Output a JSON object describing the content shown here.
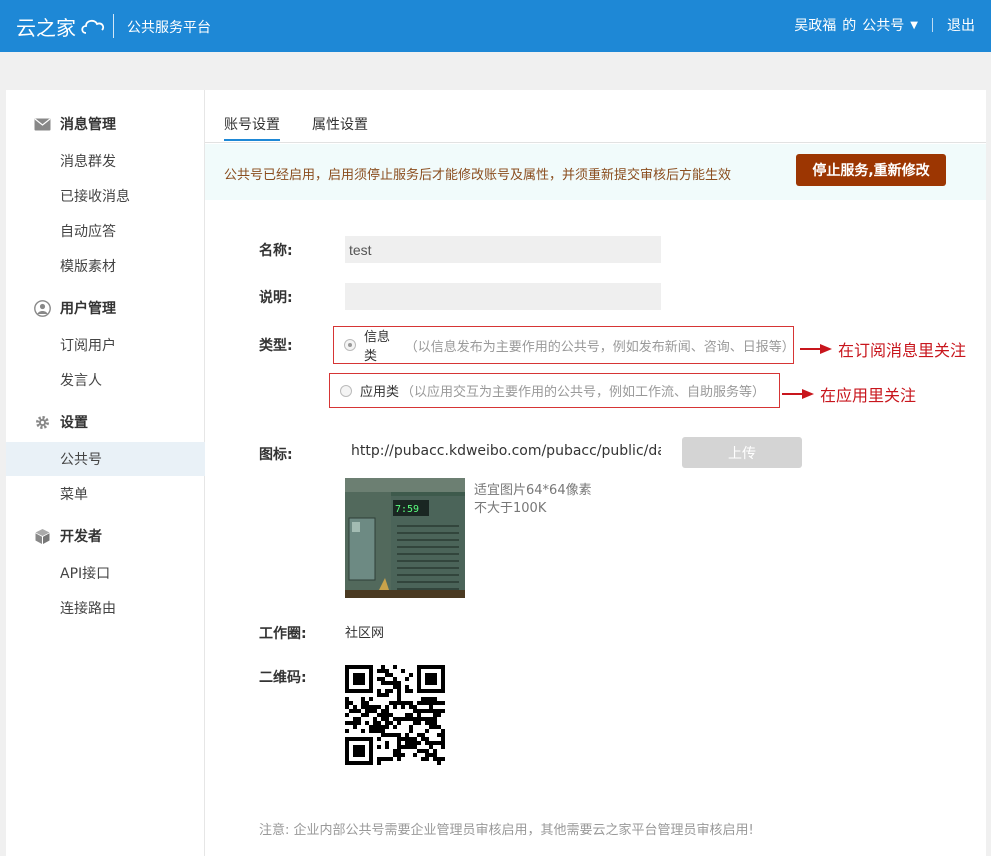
{
  "header": {
    "logo_text": "云之家",
    "platform": "公共服务平台",
    "user_name": "吴政福",
    "user_of": "的",
    "account_menu": "公共号",
    "logout": "退出"
  },
  "sidebar": {
    "groups": [
      {
        "label": "消息管理",
        "icon": "envelope-icon",
        "items": [
          "消息群发",
          "已接收消息",
          "自动应答",
          "模版素材"
        ]
      },
      {
        "label": "用户管理",
        "icon": "user-icon",
        "items": [
          "订阅用户",
          "发言人"
        ]
      },
      {
        "label": "设置",
        "icon": "gear-icon",
        "items": [
          "公共号",
          "菜单"
        ]
      },
      {
        "label": "开发者",
        "icon": "cube-icon",
        "items": [
          "API接口",
          "连接路由"
        ]
      }
    ],
    "active_item": "公共号"
  },
  "tabs": [
    {
      "label": "账号设置",
      "active": true
    },
    {
      "label": "属性设置",
      "active": false
    }
  ],
  "notice": {
    "text": "公共号已经启用，启用须停止服务后才能修改账号及属性，并须重新提交审核后方能生效",
    "button": "停止服务,重新修改"
  },
  "form": {
    "name_label": "名称:",
    "name_value": "test",
    "desc_label": "说明:",
    "desc_value": "",
    "type_label": "类型:",
    "type_options": [
      {
        "label": "信息类",
        "desc": "（以信息发布为主要作用的公共号，例如发布新闻、咨询、日报等）",
        "checked": true
      },
      {
        "label": "应用类",
        "desc": "（以应用交互为主要作用的公共号，例如工作流、自助服务等）",
        "checked": false
      }
    ],
    "icon_label": "图标:",
    "icon_url": "http://pubacc.kdweibo.com/pubacc/public/da",
    "upload_button": "上传",
    "icon_hint_size": "适宜图片64*64像素",
    "icon_hint_limit": "不大于100K",
    "circle_label": "工作圈:",
    "circle_value": "社区网",
    "qr_label": "二维码:",
    "footnote": "注意: 企业内部公共号需要企业管理员审核启用，其他需要云之家平台管理员审核启用!"
  },
  "annotations": [
    "在订阅消息里关注",
    "在应用里关注"
  ],
  "colors": {
    "header_bg": "#1e88d6",
    "stop_button_bg": "#9c3602",
    "annotation_red": "#c8161d"
  }
}
